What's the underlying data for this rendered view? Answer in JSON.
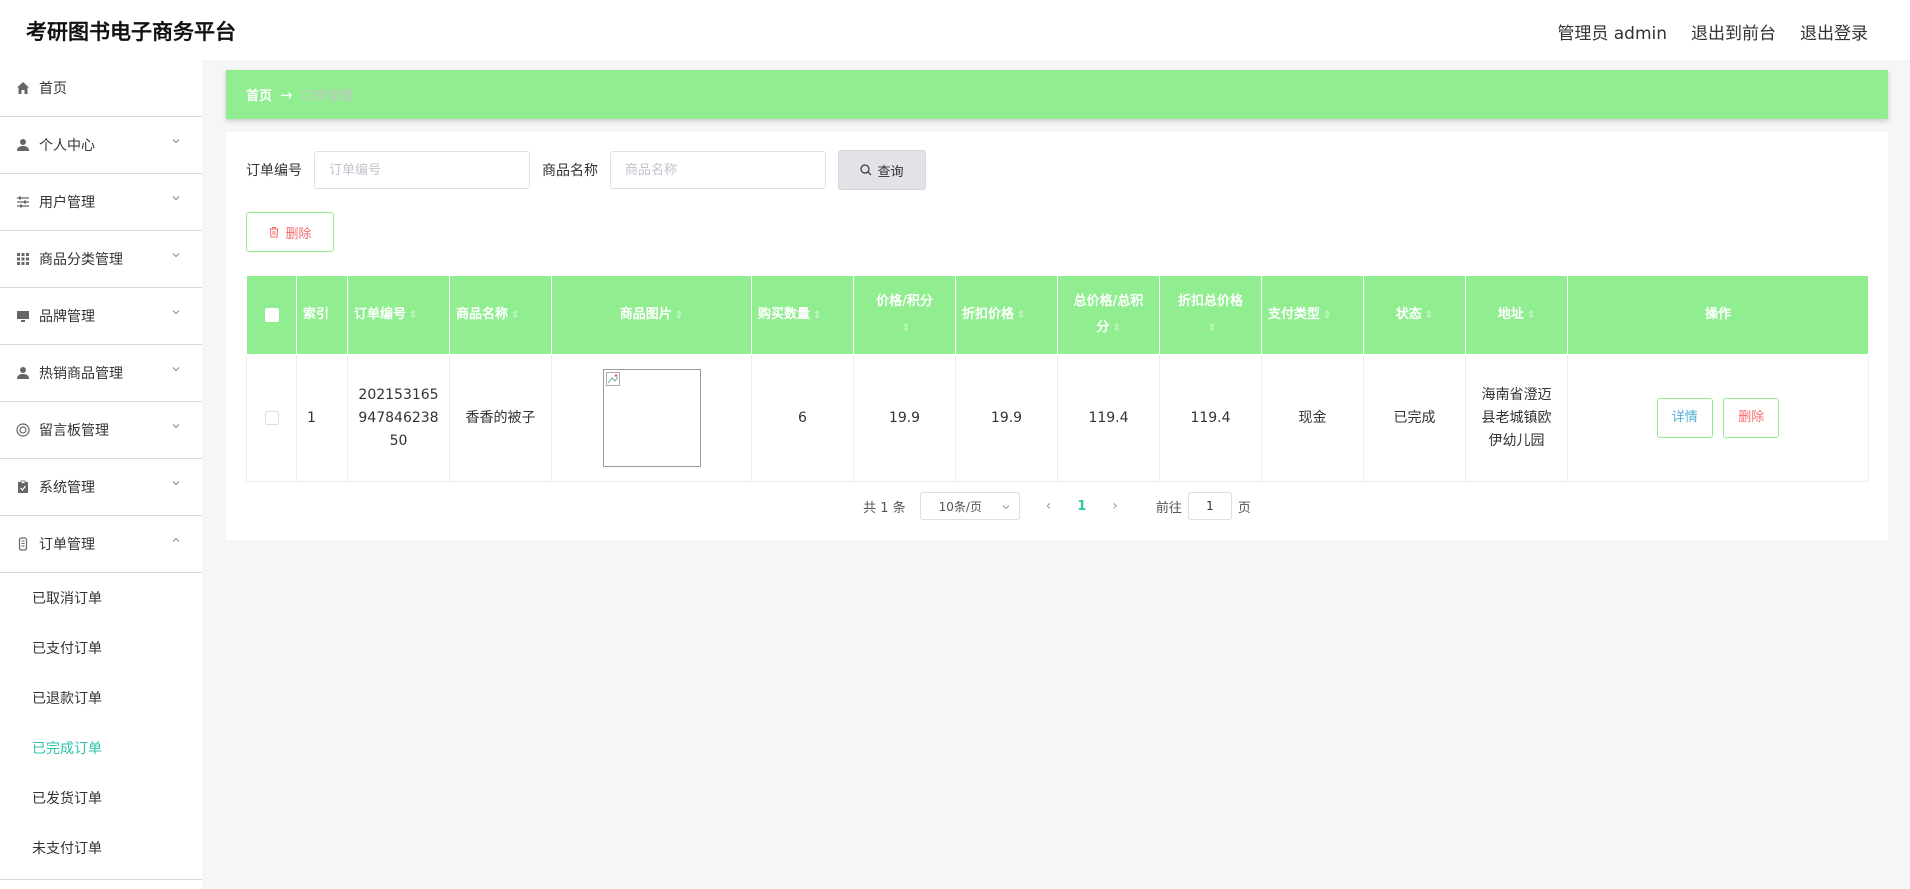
{
  "header": {
    "title": "考研图书电子商务平台",
    "admin_label": "管理员 admin",
    "to_front": "退出到前台",
    "logout": "退出登录"
  },
  "sidebar": {
    "items": [
      {
        "label": "首页",
        "icon": "home-icon"
      },
      {
        "label": "个人中心",
        "icon": "user-icon"
      },
      {
        "label": "用户管理",
        "icon": "sliders-icon"
      },
      {
        "label": "商品分类管理",
        "icon": "grid-icon"
      },
      {
        "label": "品牌管理",
        "icon": "monitor-icon"
      },
      {
        "label": "热销商品管理",
        "icon": "user-icon"
      },
      {
        "label": "留言板管理",
        "icon": "message-icon"
      },
      {
        "label": "系统管理",
        "icon": "clipboard-icon"
      },
      {
        "label": "订单管理",
        "icon": "receipt-icon"
      }
    ],
    "order_sub": [
      "已取消订单",
      "已支付订单",
      "已退款订单",
      "已完成订单",
      "已发货订单",
      "未支付订单"
    ],
    "active_sub": "已完成订单"
  },
  "breadcrumb": {
    "home": "首页",
    "arrow": "→",
    "current": "订单管理"
  },
  "search": {
    "order_no_label": "订单编号",
    "order_no_placeholder": "订单编号",
    "product_label": "商品名称",
    "product_placeholder": "商品名称",
    "query_label": "查询"
  },
  "toolbar": {
    "delete_label": "删除"
  },
  "table": {
    "headers": {
      "index": "索引",
      "order_no": "订单编号",
      "product_name": "商品名称",
      "product_image": "商品图片",
      "quantity": "购买数量",
      "price_points_1": "价格/积分",
      "discount_price": "折扣价格",
      "total_1": "总价格/总积",
      "total_2": "分",
      "discount_total": "折扣总价格",
      "pay_type": "支付类型",
      "status": "状态",
      "address": "地址",
      "actions": "操作"
    },
    "rows": [
      {
        "index": "1",
        "order_no": "202153165947846238 50",
        "order_no_lines": [
          "202153165",
          "947846238",
          "50"
        ],
        "product_name": "香香的被子",
        "quantity": "6",
        "price": "19.9",
        "discount_price": "19.9",
        "total": "119.4",
        "discount_total": "119.4",
        "pay_type": "现金",
        "status": "已完成",
        "address_lines": [
          "海南省澄迈",
          "县老城镇欧",
          "伊幼儿园"
        ],
        "detail_label": "详情",
        "delete_label": "删除"
      }
    ]
  },
  "pagination": {
    "total_text": "共 1 条",
    "page_size": "10条/页",
    "current_page": "1",
    "goto_prefix": "前往",
    "goto_value": "1",
    "goto_suffix": "页"
  },
  "colors": {
    "accent_green": "#90ee90",
    "active_teal": "#2ec4a8",
    "danger": "#f56c6c"
  }
}
